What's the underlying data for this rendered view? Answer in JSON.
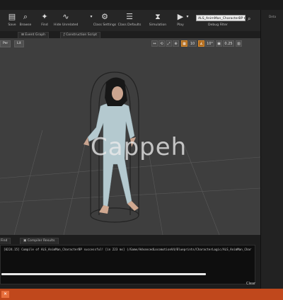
{
  "toolbar": {
    "buttons": [
      {
        "label": "Save",
        "icon": "save-icon"
      },
      {
        "label": "Browse",
        "icon": "browse-icon"
      },
      {
        "label": "Find",
        "icon": "find-icon"
      },
      {
        "label": "Hide Unrelated",
        "icon": "hide-unrelated-icon"
      },
      {
        "label": "Class Settings",
        "icon": "class-settings-icon"
      },
      {
        "label": "Class Defaults",
        "icon": "class-defaults-icon"
      },
      {
        "label": "Simulation",
        "icon": "simulation-icon"
      },
      {
        "label": "Play",
        "icon": "play-icon"
      }
    ],
    "debug_filter_value": "ALS_AnimMan_CharacterBP ▾",
    "debug_filter_label": "Debug Filter"
  },
  "tabs": {
    "event_graph": "Event Graph",
    "construction_script": "Construction Script"
  },
  "viewport": {
    "left_buttons": [
      "Per",
      "Lit"
    ],
    "tools": [
      "↔",
      "⟲",
      "⤢",
      "⊕",
      "10",
      "▦",
      "10°",
      "▣",
      "0.25",
      "▥"
    ],
    "watermark": "Cappeh"
  },
  "right_panel": {
    "label": "Deta"
  },
  "bottom": {
    "tabs": [
      "Find",
      "Compiler Results"
    ],
    "log_line": "[0224.15] Compile of ALS_AnimMan_CharacterBP successful! [in 223 ms] (/Game/AdvancedLocomotionV4/Blueprints/CharacterLogic/ALS_AnimMan_Char",
    "clear": "Clear",
    "scroll_progress": 0.79
  },
  "colors": {
    "accent": "#c0481c",
    "orange_tool": "#b06a1c",
    "viewport_bg": "#3e3e3e"
  }
}
